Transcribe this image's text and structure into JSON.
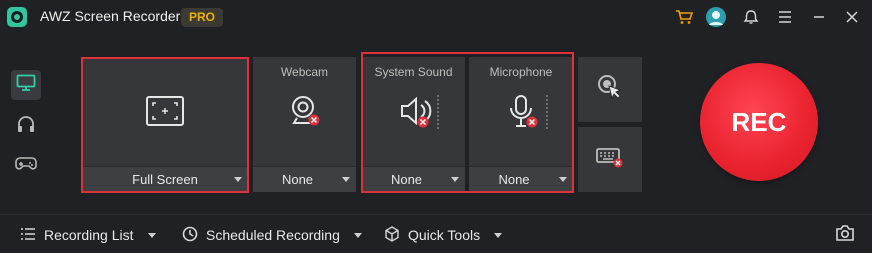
{
  "app": {
    "title": "AWZ Screen Recorder",
    "badge": "PRO"
  },
  "titlebar": {
    "icons": [
      "cart-icon",
      "user-avatar-icon",
      "bell-icon",
      "menu-icon",
      "minimize-icon",
      "close-icon"
    ],
    "accent": "#f0b000"
  },
  "rail": {
    "items": [
      "monitor-icon",
      "headphones-icon",
      "gamepad-icon"
    ],
    "active": "monitor-icon"
  },
  "panels": {
    "screen": {
      "label": "Full Screen"
    },
    "webcam": {
      "title": "Webcam",
      "value": "None"
    },
    "system_sound": {
      "title": "System Sound",
      "value": "None"
    },
    "microphone": {
      "title": "Microphone",
      "value": "None"
    }
  },
  "side_tools": [
    "cursor-click-icon",
    "keyboard-icon"
  ],
  "rec": {
    "label": "REC",
    "color": "#e9222f"
  },
  "bottombar": {
    "recording_list": "Recording List",
    "scheduled_recording": "Scheduled Recording",
    "quick_tools": "Quick Tools"
  },
  "colors": {
    "highlight": "#e0303a",
    "disabled_badge": "#e0303a",
    "panel": "#36373b",
    "background": "#202125"
  }
}
